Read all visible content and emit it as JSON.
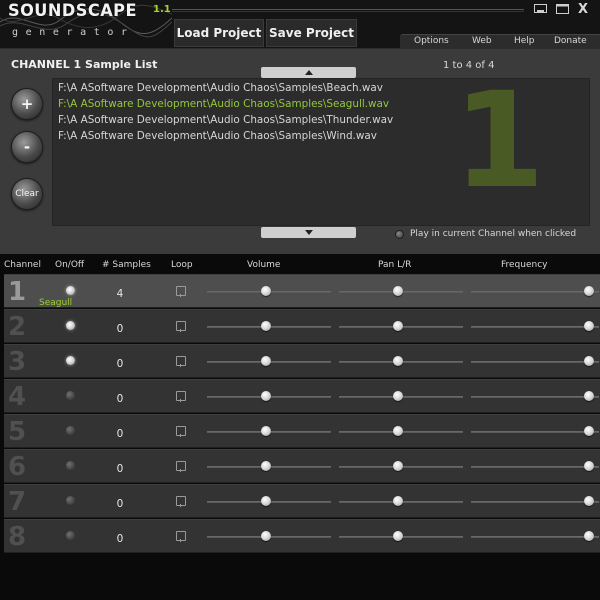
{
  "app": {
    "logo_title": "SOUNDSCAPE",
    "logo_version": "1.1",
    "logo_sub": "generator"
  },
  "toolbar": {
    "load_label": "Load Project",
    "save_label": "Save Project"
  },
  "window": {
    "close_label": "X"
  },
  "menu": {
    "options": "Options",
    "web": "Web",
    "help": "Help",
    "donate": "Donate"
  },
  "sample_panel": {
    "title": "CHANNEL 1 Sample List",
    "range": "1 to 4 of 4",
    "add_label": "+",
    "remove_label": "-",
    "clear_label": "Clear",
    "big_number": "1",
    "play_label": "Play in current Channel when clicked",
    "items": [
      {
        "path": "F:\\A ASoftware Development\\Audio Chaos\\Samples\\Beach.wav",
        "selected": false
      },
      {
        "path": "F:\\A ASoftware Development\\Audio Chaos\\Samples\\Seagull.wav",
        "selected": true
      },
      {
        "path": "F:\\A ASoftware Development\\Audio Chaos\\Samples\\Thunder.wav",
        "selected": false
      },
      {
        "path": "F:\\A ASoftware Development\\Audio Chaos\\Samples\\Wind.wav",
        "selected": false
      }
    ]
  },
  "table": {
    "headers": {
      "channel": "Channel",
      "onoff": "On/Off",
      "samples": "# Samples",
      "loop": "Loop",
      "volume": "Volume",
      "pan": "Pan L/R",
      "frequency": "Frequency"
    },
    "channels": [
      {
        "num": "1",
        "on": true,
        "samples": "4",
        "sample_name": "Seagull",
        "active": true
      },
      {
        "num": "2",
        "on": true,
        "samples": "0",
        "sample_name": "",
        "active": false
      },
      {
        "num": "3",
        "on": true,
        "samples": "0",
        "sample_name": "",
        "active": false
      },
      {
        "num": "4",
        "on": false,
        "samples": "0",
        "sample_name": "",
        "active": false
      },
      {
        "num": "5",
        "on": false,
        "samples": "0",
        "sample_name": "",
        "active": false
      },
      {
        "num": "6",
        "on": false,
        "samples": "0",
        "sample_name": "",
        "active": false
      },
      {
        "num": "7",
        "on": false,
        "samples": "0",
        "sample_name": "",
        "active": false
      },
      {
        "num": "8",
        "on": false,
        "samples": "0",
        "sample_name": "",
        "active": false
      }
    ]
  },
  "colors": {
    "selected_text": "#94c83a",
    "big_number": "#4a5a24",
    "accent_green": "#9ad02c"
  }
}
